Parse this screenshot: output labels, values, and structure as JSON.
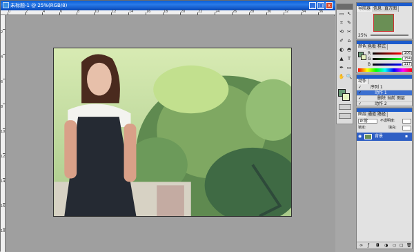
{
  "document": {
    "title": "未标题-1 @ 25%(RGB/8)",
    "ruler_top_numbers": [
      "0",
      "2",
      "4",
      "6",
      "8",
      "10",
      "12",
      "14",
      "16",
      "18",
      "20",
      "22",
      "24",
      "26",
      "28",
      "30",
      "32",
      "34",
      "36"
    ],
    "ruler_left_numbers": [
      "2",
      "4",
      "6",
      "8",
      "10",
      "12",
      "14",
      "16",
      "18"
    ]
  },
  "window_buttons": {
    "minimize": "_",
    "maximize": "□",
    "close": "x"
  },
  "tools": [
    "▭",
    "↖",
    "⌗",
    "✎",
    "⟲",
    "✂",
    "✐",
    "⌂",
    "◐",
    "◓",
    "▲",
    "T",
    "✒",
    "▭",
    "✋",
    "🔍"
  ],
  "navigator": {
    "tabs": [
      "导航器",
      "信息",
      "直方图"
    ],
    "zoom": "25%"
  },
  "color": {
    "tabs": [
      "颜色",
      "色板",
      "样式"
    ],
    "channels": [
      {
        "label": "R",
        "value": "106"
      },
      {
        "label": "G",
        "value": "154"
      },
      {
        "label": "B",
        "value": "117"
      }
    ],
    "fg_color": "#6a9a78",
    "bg_color": "#e6f3c0"
  },
  "actions": {
    "tabs": [
      "动作"
    ],
    "rows": [
      {
        "label": "序列 1"
      },
      {
        "label": "动作 1"
      },
      {
        "label": "删除 当前 图层"
      },
      {
        "label": "动作 2"
      }
    ]
  },
  "layers": {
    "tabs": [
      "图层",
      "通道",
      "路径"
    ],
    "mode": "正常",
    "opacity_label": "不透明度:",
    "lock_label": "锁定:",
    "fill_label": "填充:",
    "layer_name": "背景"
  },
  "colors": {
    "accent": "#1d5ccc",
    "titlebar": "#0a5fd8",
    "canvas_bg": "#9f9f9f"
  }
}
